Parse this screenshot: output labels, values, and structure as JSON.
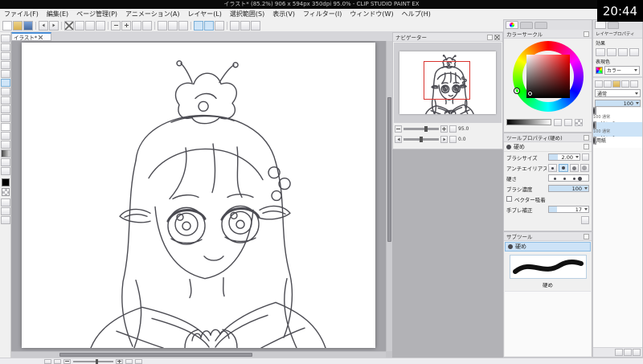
{
  "clock": "20:44",
  "window": {
    "title": "イラスト* (85.2%) 906 x 594px 350dpi 95.0% - CLIP STUDIO PAINT EX"
  },
  "menu": {
    "items": [
      "ファイル(F)",
      "編集(E)",
      "ページ管理(P)",
      "アニメーション(A)",
      "レイヤー(L)",
      "選択範囲(S)",
      "表示(V)",
      "フィルター(I)",
      "ウィンドウ(W)",
      "ヘルプ(H)"
    ]
  },
  "document": {
    "tab": "イラスト*"
  },
  "navigator": {
    "title": "ナビゲーター",
    "zoom_value": "95.0",
    "rotation_value": "0.0"
  },
  "color_panel": {
    "title": "カラーサークル",
    "selected_color": "#000000",
    "square_hue": "#ff0000"
  },
  "tool_property": {
    "title": "ツールプロパティ(硬め)",
    "subtool_name": "硬め",
    "rows": [
      {
        "label": "ブラシサイズ",
        "value": "2.00"
      },
      {
        "label": "アンチエイリアス",
        "value": ""
      },
      {
        "label": "硬さ",
        "value": ""
      },
      {
        "label": "ブラシ濃度",
        "value": "100"
      },
      {
        "label": "ベクター吸着",
        "value": ""
      },
      {
        "label": "手ブレ補正",
        "value": "17"
      }
    ]
  },
  "subtool_panel": {
    "title": "サブツール",
    "selected_name": "硬め",
    "item_name": "硬め"
  },
  "layer_property": {
    "title": "レイヤープロパティ",
    "effect_label": "効果",
    "expression_label": "表現色",
    "expression_value": "カラー"
  },
  "layer_panel": {
    "blend_mode": "通常",
    "opacity_value": "100",
    "layers": [
      {
        "meta": "100 通常",
        "name": "レイヤー2"
      },
      {
        "meta": "100 通常",
        "name": "レイヤー1"
      },
      {
        "meta": "",
        "name": "用紙"
      }
    ]
  }
}
